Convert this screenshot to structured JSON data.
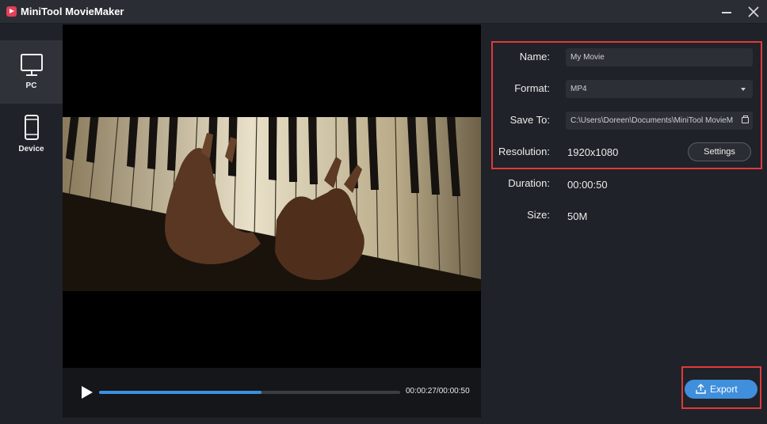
{
  "app": {
    "title": "MiniTool MovieMaker"
  },
  "sidebar": {
    "items": [
      {
        "label": "PC",
        "icon": "monitor-icon",
        "active": true
      },
      {
        "label": "Device",
        "icon": "phone-icon",
        "active": false
      }
    ]
  },
  "player": {
    "time_display": "00:00:27/00:00:50",
    "progress_fraction": 0.54
  },
  "export_settings": {
    "name_label": "Name:",
    "name_value": "My Movie",
    "format_label": "Format:",
    "format_value": "MP4",
    "save_to_label": "Save To:",
    "save_to_value": "C:\\Users\\Doreen\\Documents\\MiniTool MovieM",
    "resolution_label": "Resolution:",
    "resolution_value": "1920x1080",
    "settings_button": "Settings",
    "duration_label": "Duration:",
    "duration_value": "00:00:50",
    "size_label": "Size:",
    "size_value": "50M"
  },
  "export_button": "Export",
  "colors": {
    "accent": "#3f8fdc",
    "highlight": "#e03a3a",
    "progress": "#3d8fe0",
    "background": "#1f2228"
  }
}
